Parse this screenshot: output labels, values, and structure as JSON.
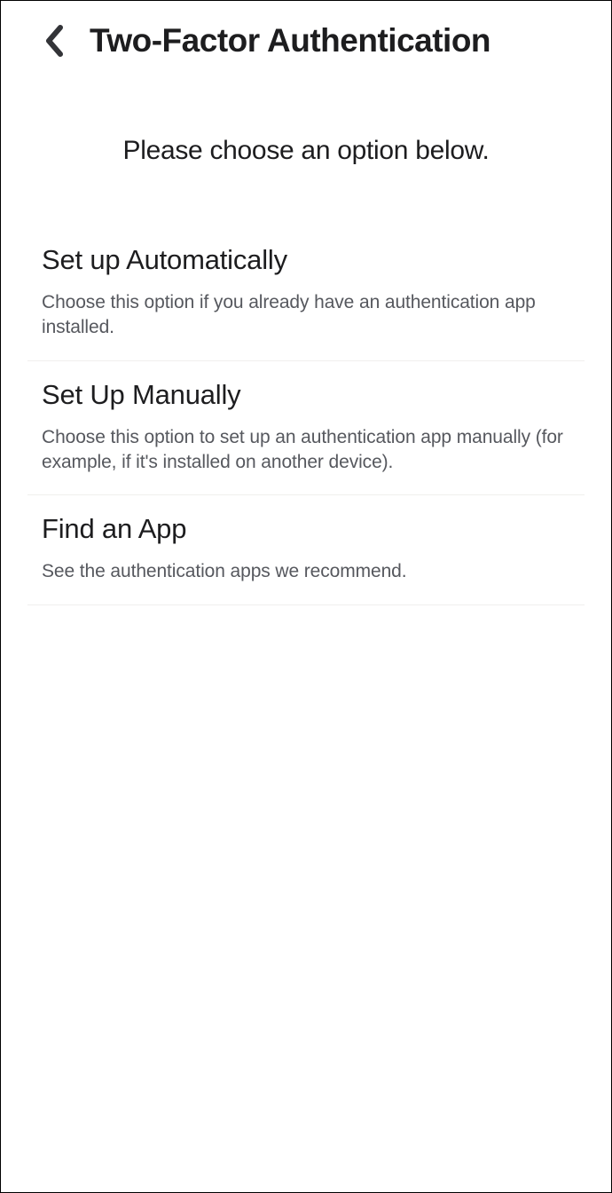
{
  "header": {
    "title": "Two-Factor Authentication"
  },
  "subtitle": "Please choose an option below.",
  "options": [
    {
      "title": "Set up Automatically",
      "description": "Choose this option if you already have an authentication app installed."
    },
    {
      "title": "Set Up Manually",
      "description": "Choose this option to set up an authentication app manually (for example, if it's installed on another device)."
    },
    {
      "title": "Find an App",
      "description": "See the authentication apps we recommend."
    }
  ]
}
